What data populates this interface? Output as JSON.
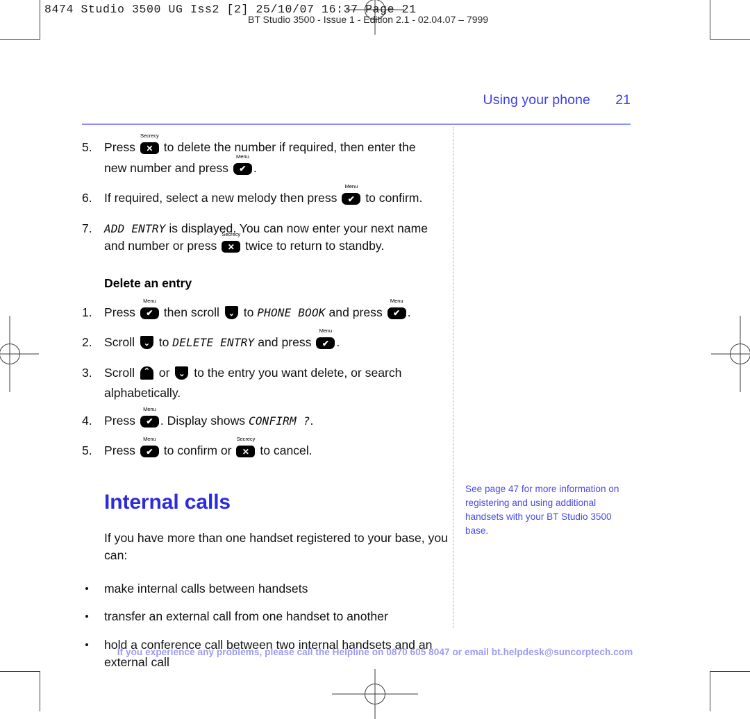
{
  "prepress": {
    "job_line": "8474 Studio 3500 UG Iss2 [2]  25/10/07  16:37  Page 21",
    "imprint_line": "BT Studio 3500 - Issue 1 - Edition 2.1 - 02.04.07 – 7999"
  },
  "header": {
    "running_title": "Using your phone",
    "folio": "21"
  },
  "colors": {
    "heading_blue": "#2b2bdd",
    "running_head_blue": "#3d3df0",
    "rule_blue": "#8f8ff5",
    "side_note_blue": "#4a4aec",
    "footer_blue": "#9b9bf5",
    "key_black": "#000000"
  },
  "keys": {
    "secrecy": {
      "cap": "Secrecy",
      "glyph": "✕",
      "name": "secrecy-key"
    },
    "menu": {
      "cap": "Menu",
      "glyph": "✔",
      "name": "menu-key"
    },
    "scroll_up": {
      "glyph": "⌃",
      "name": "scroll-up-key"
    },
    "scroll_down": {
      "glyph": "⌄",
      "name": "scroll-down-key"
    }
  },
  "steps_top": [
    {
      "num": "5.",
      "parts": [
        {
          "t": "text",
          "v": "Press "
        },
        {
          "t": "key",
          "v": "secrecy"
        },
        {
          "t": "text",
          "v": " to delete the number if required, then enter the new number and press "
        },
        {
          "t": "key",
          "v": "menu"
        },
        {
          "t": "text",
          "v": "."
        }
      ]
    },
    {
      "num": "6.",
      "parts": [
        {
          "t": "text",
          "v": "If required, select a new melody then press "
        },
        {
          "t": "key",
          "v": "menu"
        },
        {
          "t": "text",
          "v": " to confirm."
        }
      ]
    },
    {
      "num": "7.",
      "parts": [
        {
          "t": "lcd",
          "v": "ADD ENTRY"
        },
        {
          "t": "text",
          "v": " is displayed. You can now enter your next name and number or press "
        },
        {
          "t": "key",
          "v": "secrecy"
        },
        {
          "t": "text",
          "v": " twice to return to standby."
        }
      ]
    }
  ],
  "delete_section": {
    "subhead": "Delete an entry",
    "steps": [
      {
        "num": "1.",
        "parts": [
          {
            "t": "text",
            "v": "Press "
          },
          {
            "t": "key",
            "v": "menu"
          },
          {
            "t": "text",
            "v": " then scroll "
          },
          {
            "t": "key",
            "v": "scroll_down"
          },
          {
            "t": "text",
            "v": " to "
          },
          {
            "t": "lcd",
            "v": "PHONE BOOK"
          },
          {
            "t": "text",
            "v": " and press "
          },
          {
            "t": "key",
            "v": "menu"
          },
          {
            "t": "text",
            "v": "."
          }
        ]
      },
      {
        "num": "2.",
        "parts": [
          {
            "t": "text",
            "v": "Scroll "
          },
          {
            "t": "key",
            "v": "scroll_down"
          },
          {
            "t": "text",
            "v": " to "
          },
          {
            "t": "lcd",
            "v": "DELETE ENTRY"
          },
          {
            "t": "text",
            "v": " and press "
          },
          {
            "t": "key",
            "v": "menu"
          },
          {
            "t": "text",
            "v": "."
          }
        ]
      },
      {
        "num": "3.",
        "parts": [
          {
            "t": "text",
            "v": "Scroll "
          },
          {
            "t": "key",
            "v": "scroll_up"
          },
          {
            "t": "text",
            "v": " or "
          },
          {
            "t": "key",
            "v": "scroll_down"
          },
          {
            "t": "text",
            "v": " to the entry you want delete, or search alphabetically."
          }
        ]
      },
      {
        "num": "4.",
        "parts": [
          {
            "t": "text",
            "v": "Press "
          },
          {
            "t": "key",
            "v": "menu"
          },
          {
            "t": "text",
            "v": ". Display shows "
          },
          {
            "t": "lcd",
            "v": "CONFIRM ?"
          },
          {
            "t": "text",
            "v": "."
          }
        ]
      },
      {
        "num": "5.",
        "parts": [
          {
            "t": "text",
            "v": "Press "
          },
          {
            "t": "key",
            "v": "menu"
          },
          {
            "t": "text",
            "v": " to confirm or "
          },
          {
            "t": "key",
            "v": "secrecy"
          },
          {
            "t": "text",
            "v": " to cancel."
          }
        ]
      }
    ]
  },
  "internal_calls": {
    "heading": "Internal calls",
    "intro": "If you have more than one handset registered to your base, you can:",
    "bullets": [
      "make internal calls between handsets",
      "transfer an external call from one handset to another",
      "hold a conference call between two internal handsets and an external call"
    ]
  },
  "side_note": {
    "text": "See page 47 for more information on registering and using additional handsets with your BT Studio 3500 base."
  },
  "footer": {
    "text": "If you experience any problems, please call the Helpline on 0870 605 8047 or email bt.helpdesk@suncorptech.com"
  }
}
